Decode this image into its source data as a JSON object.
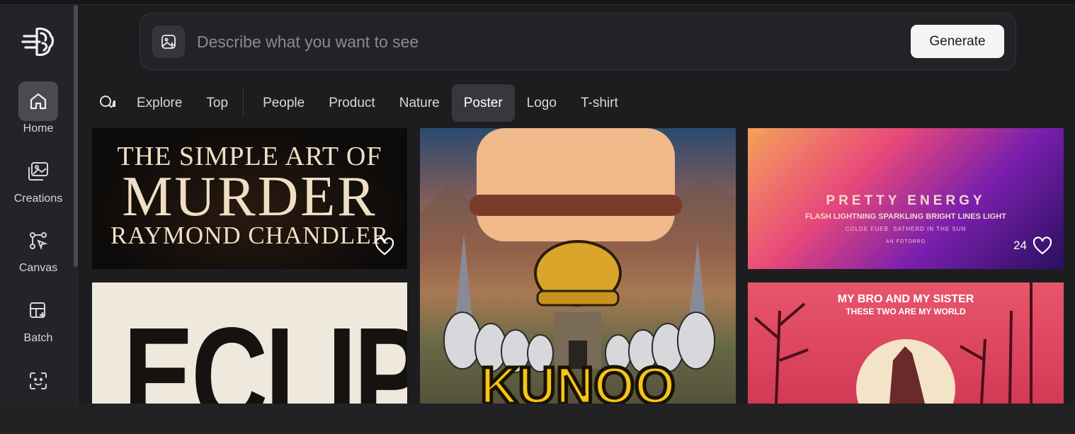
{
  "sidebar": {
    "items": [
      {
        "label": "Home",
        "icon": "home-icon",
        "active": true
      },
      {
        "label": "Creations",
        "icon": "image-gallery-icon"
      },
      {
        "label": "Canvas",
        "icon": "canvas-icon"
      },
      {
        "label": "Batch",
        "icon": "batch-icon"
      },
      {
        "label": "",
        "icon": "face-scan-icon"
      }
    ]
  },
  "prompt": {
    "placeholder": "Describe what you want to see",
    "value": "",
    "generate_label": "Generate"
  },
  "tabs": {
    "items": [
      "Explore",
      "Top",
      "People",
      "Product",
      "Nature",
      "Poster",
      "Logo",
      "T-shirt"
    ],
    "active": "Poster"
  },
  "gallery": [
    {
      "title": "THE SIMPLE ART OF",
      "subtitle": "MURDER",
      "author": "RAYMOND CHANDLER",
      "likes": ""
    },
    {
      "title": "KUNOO"
    },
    {
      "title": "PRETTY ENERGY",
      "subtitle": "FLASH LIGHTNING SPARKLING BRIGHT LINES LIGHT",
      "line3": "COLDE FUEB. SATHERD IN THE SUN",
      "line4": "AN FOTOBRO",
      "likes": "24"
    },
    {
      "title": "ECLIPSE"
    },
    {
      "title": "MY BRO AND MY SISTER",
      "subtitle": "THESE TWO ARE MY WORLD"
    }
  ],
  "colors": {
    "background": "#1d1d20",
    "sidebar": "#242428",
    "active_tab": "#37373c",
    "generate_button": "#f5f5f5"
  }
}
